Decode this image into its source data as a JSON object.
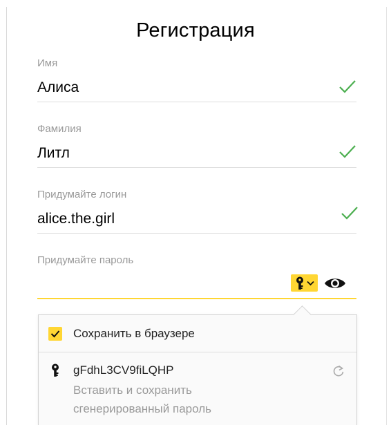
{
  "form": {
    "title": "Регистрация",
    "fields": [
      {
        "label": "Имя",
        "value": "Алиса",
        "valid": true
      },
      {
        "label": "Фамилия",
        "value": "Литл",
        "valid": true
      },
      {
        "label": "Придумайте логин",
        "value": "alice.the.girl",
        "valid": true
      }
    ],
    "password": {
      "label": "Придумайте пароль",
      "value": ""
    }
  },
  "popup": {
    "save_label": "Сохранить в браузере",
    "save_checked": true,
    "generated_password": "gFdhL3CV9fiLQHP",
    "insert_line1": "Вставить и сохранить",
    "insert_line2": "сгенерированный пароль"
  },
  "colors": {
    "accent": "#ffd633",
    "check": "#4caf50",
    "label": "#999999"
  },
  "icons": [
    "check-icon",
    "key-icon",
    "chevron-down-icon",
    "eye-icon",
    "refresh-icon"
  ]
}
